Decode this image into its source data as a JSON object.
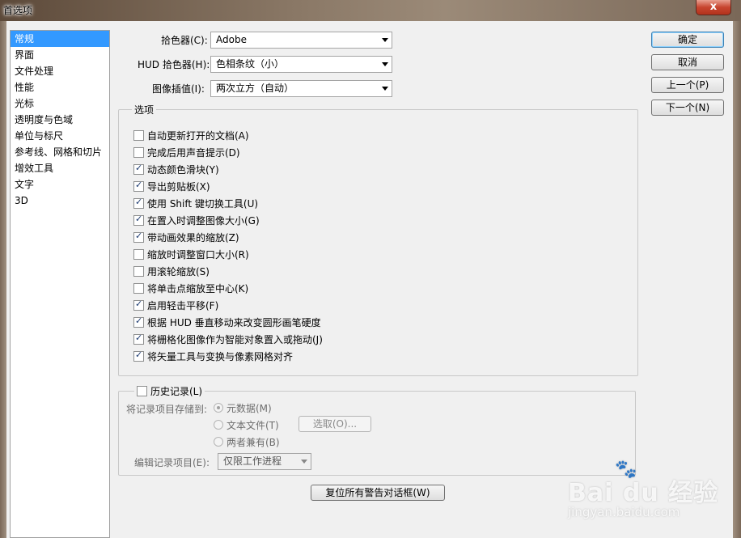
{
  "window": {
    "title": "首选项",
    "close_symbol": "x"
  },
  "nav": {
    "items": [
      {
        "label": "常规",
        "selected": true
      },
      {
        "label": "界面"
      },
      {
        "label": "文件处理"
      },
      {
        "label": "性能"
      },
      {
        "label": "光标"
      },
      {
        "label": "透明度与色域"
      },
      {
        "label": "单位与标尺"
      },
      {
        "label": "参考线、网格和切片"
      },
      {
        "label": "增效工具"
      },
      {
        "label": "文字"
      },
      {
        "label": "3D"
      }
    ]
  },
  "fields": {
    "color_picker": {
      "label": "拾色器(C):",
      "value": "Adobe"
    },
    "hud_color_picker": {
      "label": "HUD 拾色器(H):",
      "value": "色相条纹（小）"
    },
    "interpolation": {
      "label": "图像插值(I):",
      "value": "两次立方（自动）"
    }
  },
  "options": {
    "title": "选项",
    "checkboxes": [
      {
        "label": "自动更新打开的文档(A)",
        "checked": false
      },
      {
        "label": "完成后用声音提示(D)",
        "checked": false
      },
      {
        "label": "动态颜色滑块(Y)",
        "checked": true
      },
      {
        "label": "导出剪贴板(X)",
        "checked": true
      },
      {
        "label": "使用 Shift 键切换工具(U)",
        "checked": true
      },
      {
        "label": "在置入时调整图像大小(G)",
        "checked": true
      },
      {
        "label": "带动画效果的缩放(Z)",
        "checked": true
      },
      {
        "label": "缩放时调整窗口大小(R)",
        "checked": false
      },
      {
        "label": "用滚轮缩放(S)",
        "checked": false
      },
      {
        "label": "将单击点缩放至中心(K)",
        "checked": false
      },
      {
        "label": "启用轻击平移(F)",
        "checked": true
      },
      {
        "label": "根据 HUD 垂直移动来改变圆形画笔硬度",
        "checked": true
      },
      {
        "label": "将栅格化图像作为智能对象置入或拖动(J)",
        "checked": true
      },
      {
        "label": "将矢量工具与变换与像素网格对齐",
        "checked": true
      }
    ]
  },
  "history": {
    "checkbox_label": "历史记录(L)",
    "checked": false,
    "save_to_label": "将记录项目存储到:",
    "radio_metadata": "元数据(M)",
    "radio_textfile": "文本文件(T)",
    "radio_both": "两者兼有(B)",
    "choose_button": "选取(O)...",
    "edit_log_label": "编辑记录项目(E):",
    "edit_log_value": "仅限工作进程"
  },
  "buttons": {
    "ok": "确定",
    "cancel": "取消",
    "prev": "上一个(P)",
    "next": "下一个(N)",
    "reset_warnings": "复位所有警告对话框(W)"
  },
  "watermark": {
    "main": "Bai du 经验",
    "sub": "jingyan.baidu.com"
  }
}
